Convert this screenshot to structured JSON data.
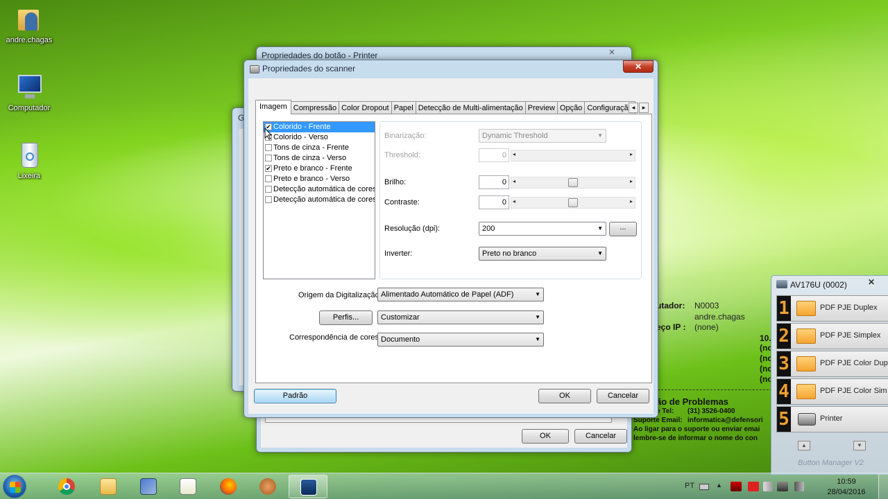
{
  "desktop": {
    "icons": [
      {
        "label": "andre.chagas"
      },
      {
        "label": "Computador"
      },
      {
        "label": "Lixeira"
      }
    ]
  },
  "bg_info": {
    "computer_label": "utador:",
    "computer_value": "N0003",
    "user_value": "andre.chagas",
    "ip_label": "eço IP :",
    "ip_value": "(none)",
    "ip_extra": "10.",
    "none_lines": [
      "(no",
      "(no",
      "(no",
      "(no"
    ],
    "support_title": "ão de Problemas",
    "support_tel_label": "e Tel:",
    "support_tel": "(31) 3526-0400",
    "support_email_label": "Suporte Email:",
    "support_email": "informatica@defensori",
    "note1": "Ao ligar para o suporte ou enviar emai",
    "note2": "lembre-se de informar o nome do con"
  },
  "back_window": {
    "title": "Propriedades do botão - Printer",
    "close": "✕",
    "ok": "OK",
    "cancel": "Cancelar"
  },
  "mid_window": {
    "title": "G"
  },
  "scanner": {
    "title": "Propriedades do scanner",
    "close": "✕",
    "tabs": [
      "Imagem",
      "Compressão",
      "Color Dropout",
      "Papel",
      "Detecção de Multi-alimentação",
      "Preview",
      "Opção",
      "Configuração"
    ],
    "tab_scroll_left": "◂",
    "tab_scroll_right": "▸",
    "image_list": [
      {
        "label": "Colorido - Frente",
        "checked": true,
        "selected": true
      },
      {
        "label": "Colorido - Verso",
        "checked": false
      },
      {
        "label": "Tons de cinza - Frente",
        "checked": false
      },
      {
        "label": "Tons de cinza - Verso",
        "checked": false
      },
      {
        "label": "Preto e branco - Frente",
        "checked": true
      },
      {
        "label": "Preto e branco - Verso",
        "checked": false
      },
      {
        "label": "Detecção automática de cores-F",
        "checked": false
      },
      {
        "label": "Detecção automática de cores-V",
        "checked": false
      }
    ],
    "check_mark": "✔",
    "binarization_label": "Binarização:",
    "binarization_value": "Dynamic Threshold",
    "threshold_label": "Threshold:",
    "threshold_value": "0",
    "brightness_label": "Brilho:",
    "brightness_value": "0",
    "contrast_label": "Contraste:",
    "contrast_value": "0",
    "resolution_label": "Resolução (dpi):",
    "resolution_value": "200",
    "resolution_more": "...",
    "invert_label": "Inverter:",
    "invert_value": "Preto no branco",
    "source_label": "Origem da Digitalização:",
    "source_value": "Alimentado Automático de Papel (ADF)",
    "profile_button": "Perfis...",
    "profile_value": "Customizar",
    "color_match_label": "Correspondência de cores:",
    "color_match_value": "Documento",
    "default_button": "Padrão",
    "ok_button": "OK",
    "cancel_button": "Cancelar",
    "slider_left": "◂",
    "slider_right": "▸",
    "combo_arrow": "▼"
  },
  "button_manager": {
    "title": "AV176U (0002)",
    "close": "✕",
    "rows": [
      {
        "num": "1",
        "label": "PDF PJE Duplex"
      },
      {
        "num": "2",
        "label": "PDF PJE Simplex"
      },
      {
        "num": "3",
        "label": "PDF PJE Color Dup"
      },
      {
        "num": "4",
        "label": "PDF PJE Color Sim"
      },
      {
        "num": "5",
        "label": "Printer"
      }
    ],
    "up": "▲",
    "down": "▼",
    "footer": "Button Manager V2"
  },
  "taskbar": {
    "lang": "PT",
    "time": "10:59",
    "date": "28/04/2016"
  }
}
